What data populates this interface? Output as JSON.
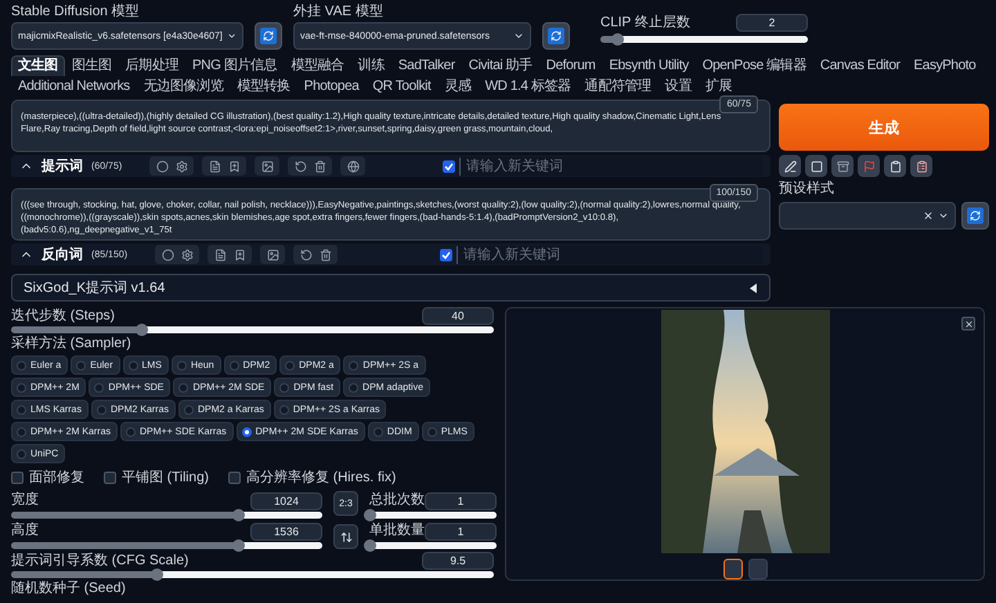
{
  "settings": {
    "model": {
      "label": "Stable Diffusion 模型",
      "value": "majicmixRealistic_v6.safetensors [e4a30e4607]"
    },
    "vae": {
      "label": "外挂 VAE 模型",
      "value": "vae-ft-mse-840000-ema-pruned.safetensors"
    },
    "clip": {
      "label": "CLIP 终止层数",
      "value": "2",
      "level": 0.08
    }
  },
  "tabs": [
    {
      "label": "文生图",
      "selected": true
    },
    {
      "label": "图生图",
      "selected": false
    },
    {
      "label": "后期处理",
      "selected": false
    },
    {
      "label": "PNG 图片信息",
      "selected": false
    },
    {
      "label": "模型融合",
      "selected": false
    },
    {
      "label": "训练",
      "selected": false
    },
    {
      "label": "SadTalker",
      "selected": false
    },
    {
      "label": "Civitai 助手",
      "selected": false
    },
    {
      "label": "Deforum",
      "selected": false
    },
    {
      "label": "Ebsynth Utility",
      "selected": false
    },
    {
      "label": "OpenPose 编辑器",
      "selected": false
    },
    {
      "label": "Canvas Editor",
      "selected": false
    },
    {
      "label": "EasyPhoto",
      "selected": false
    },
    {
      "label": "Additional Networks",
      "selected": false
    },
    {
      "label": "无边图像浏览",
      "selected": false
    },
    {
      "label": "模型转换",
      "selected": false
    },
    {
      "label": "Photopea",
      "selected": false
    },
    {
      "label": "QR Toolkit",
      "selected": false
    },
    {
      "label": "灵感",
      "selected": false
    },
    {
      "label": "WD 1.4 标签器",
      "selected": false
    },
    {
      "label": "通配符管理",
      "selected": false
    },
    {
      "label": "设置",
      "selected": false
    },
    {
      "label": "扩展",
      "selected": false
    }
  ],
  "prompt": {
    "text": "(masterpiece),((ultra-detailed)),(highly detailed CG illustration),(best quality:1.2),High quality texture,intricate details,detailed texture,High quality shadow,Cinematic Light,Lens Flare,Ray tracing,Depth of field,light source contrast,<lora:epi_noiseoffset2:1>,river,sunset,spring,daisy,green grass,mountain,cloud,",
    "counter": "60/75",
    "label": "提示词",
    "count": "(60/75)",
    "keyword_placeholder": "请输入新关键词",
    "checked": true
  },
  "negative_prompt": {
    "text": "(((see through, stocking, hat, glove, choker, collar, nail polish, necklace))),EasyNegative,paintings,sketches,(worst quality:2),(low quality:2),(normal quality:2),lowres,normal quality,((monochrome)),((grayscale)),skin spots,acnes,skin blemishes,age spot,extra fingers,fewer fingers,(bad-hands-5:1.4),(badPromptVersion2_v10:0.8),(badv5:0.6),ng_deepnegative_v1_75t",
    "counter": "100/150",
    "label": "反向词",
    "count": "(85/150)",
    "keyword_placeholder": "请输入新关键词",
    "checked": true
  },
  "generate_button": "生成",
  "styles": {
    "label": "预设样式"
  },
  "extension": {
    "title": "SixGod_K提示词 v1.64",
    "expanded": false
  },
  "steps": {
    "label": "迭代步数 (Steps)",
    "value": "40",
    "level": 0.27
  },
  "sampler": {
    "label": "采样方法 (Sampler)",
    "options": [
      {
        "label": "Euler a",
        "selected": false
      },
      {
        "label": "Euler",
        "selected": false
      },
      {
        "label": "LMS",
        "selected": false
      },
      {
        "label": "Heun",
        "selected": false
      },
      {
        "label": "DPM2",
        "selected": false
      },
      {
        "label": "DPM2 a",
        "selected": false
      },
      {
        "label": "DPM++ 2S a",
        "selected": false
      },
      {
        "label": "DPM++ 2M",
        "selected": false
      },
      {
        "label": "DPM++ SDE",
        "selected": false
      },
      {
        "label": "DPM++ 2M SDE",
        "selected": false
      },
      {
        "label": "DPM fast",
        "selected": false
      },
      {
        "label": "DPM adaptive",
        "selected": false
      },
      {
        "label": "LMS Karras",
        "selected": false
      },
      {
        "label": "DPM2 Karras",
        "selected": false
      },
      {
        "label": "DPM2 a Karras",
        "selected": false
      },
      {
        "label": "DPM++ 2S a Karras",
        "selected": false
      },
      {
        "label": "DPM++ 2M Karras",
        "selected": false
      },
      {
        "label": "DPM++ SDE Karras",
        "selected": false
      },
      {
        "label": "DPM++ 2M SDE Karras",
        "selected": true
      },
      {
        "label": "DDIM",
        "selected": false
      },
      {
        "label": "PLMS",
        "selected": false
      },
      {
        "label": "UniPC",
        "selected": false
      }
    ]
  },
  "options": [
    {
      "label": "面部修复",
      "checked": false
    },
    {
      "label": "平铺图 (Tiling)",
      "checked": false
    },
    {
      "label": "高分辨率修复 (Hires. fix)",
      "checked": false
    }
  ],
  "width": {
    "label": "宽度",
    "value": "1024",
    "level": 0.73
  },
  "height": {
    "label": "高度",
    "value": "1536",
    "level": 0.73
  },
  "ratio": "2:3",
  "batch_count": {
    "label": "总批次数",
    "value": "1",
    "level": 0
  },
  "batch_size": {
    "label": "单批数量",
    "value": "1",
    "level": 0
  },
  "cfg": {
    "label": "提示词引导系数 (CFG Scale)",
    "value": "9.5",
    "level": 0.3
  },
  "seed": {
    "label": "随机数种子 (Seed)"
  },
  "gallery": {
    "thumbnails": [
      {
        "selected": true
      },
      {
        "selected": false
      }
    ]
  }
}
